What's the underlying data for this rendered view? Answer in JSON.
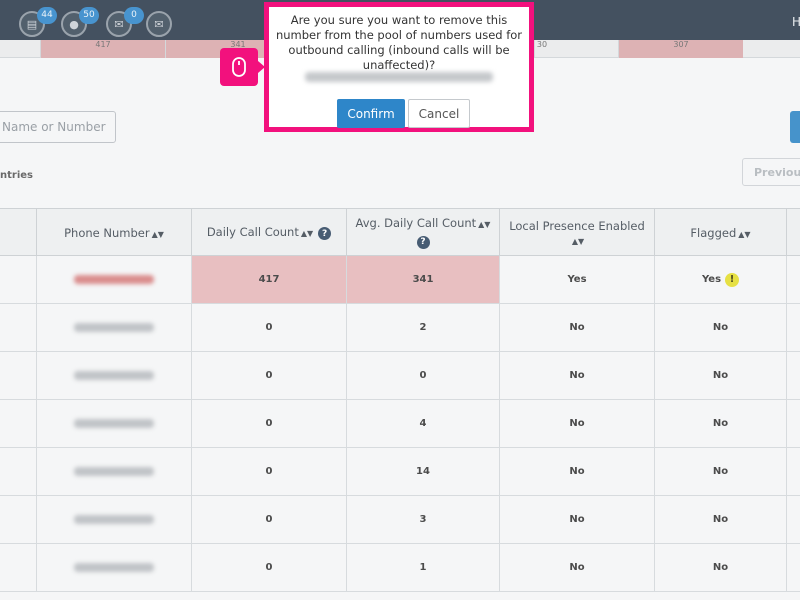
{
  "nav": {
    "icons": [
      {
        "name": "reports-icon",
        "glyph": "▤",
        "badge": "44"
      },
      {
        "name": "chat-icon",
        "glyph": "●",
        "badge": "50"
      },
      {
        "name": "mail-icon",
        "glyph": "✉",
        "badge": "0"
      },
      {
        "name": "inbox-icon",
        "glyph": "✉",
        "badge": ""
      }
    ],
    "user_initial": "H"
  },
  "strip": {
    "values": [
      "417",
      "341",
      "30",
      "307"
    ]
  },
  "search": {
    "placeholder": "Name or Number"
  },
  "entries_label": "ntries",
  "pagination": {
    "previous_label": "Previous"
  },
  "table": {
    "headers": {
      "phone_number": "Phone Number",
      "daily_call_count": "Daily Call Count",
      "avg_daily_call_count": "Avg. Daily Call Count",
      "local_presence": "Local Presence Enabled",
      "flagged": "Flagged"
    },
    "rows": [
      {
        "daily": "417",
        "avg": "341",
        "local": "Yes",
        "flagged": "Yes",
        "highlight": true
      },
      {
        "daily": "0",
        "avg": "2",
        "local": "No",
        "flagged": "No",
        "highlight": false
      },
      {
        "daily": "0",
        "avg": "0",
        "local": "No",
        "flagged": "No",
        "highlight": false
      },
      {
        "daily": "0",
        "avg": "4",
        "local": "No",
        "flagged": "No",
        "highlight": false
      },
      {
        "daily": "0",
        "avg": "14",
        "local": "No",
        "flagged": "No",
        "highlight": false
      },
      {
        "daily": "0",
        "avg": "3",
        "local": "No",
        "flagged": "No",
        "highlight": false
      },
      {
        "daily": "0",
        "avg": "1",
        "local": "No",
        "flagged": "No",
        "highlight": false
      }
    ]
  },
  "dialog": {
    "message": "Are you sure you want to remove this number from the pool of numbers used for outbound calling (inbound calls will be unaffected)?",
    "confirm_label": "Confirm",
    "cancel_label": "Cancel"
  },
  "colors": {
    "highlight_pink": "#f2117d",
    "primary_blue": "#2e86c9",
    "navbar": "#2b3a4a",
    "flag_yellow": "#e3dc2b"
  }
}
